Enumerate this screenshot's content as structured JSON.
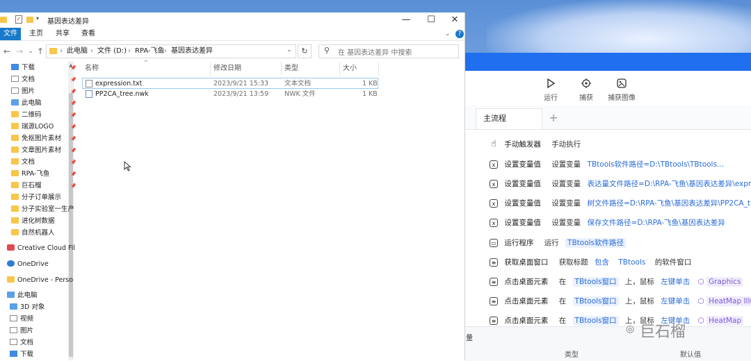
{
  "explorer": {
    "title": "基因表达差异",
    "ribbon": {
      "file": "文件",
      "home": "主页",
      "share": "共享",
      "view": "查看"
    },
    "breadcrumb": [
      "此电脑",
      "文件 (D:)",
      "RPA-飞鱼",
      "基因表达差异"
    ],
    "search_placeholder": "在 基因表达差异 中搜索",
    "columns": {
      "name": "名称",
      "date": "修改日期",
      "type": "类型",
      "size": "大小"
    },
    "files": [
      {
        "name": "expression.txt",
        "date": "2023/9/21 15:33",
        "type": "文本文档",
        "size": "1 KB"
      },
      {
        "name": "PP2CA_tree.nwk",
        "date": "2023/9/21 13:59",
        "type": "NWK 文件",
        "size": "1 KB"
      }
    ],
    "nav_items": [
      {
        "label": "下载",
        "icon": "download-icon",
        "pinned": true
      },
      {
        "label": "文档",
        "icon": "document-icon",
        "pinned": true
      },
      {
        "label": "图片",
        "icon": "pictures-icon",
        "pinned": true
      },
      {
        "label": "此电脑",
        "icon": "computer-icon",
        "pinned": true
      },
      {
        "label": "二维码",
        "icon": "folder-icon",
        "pinned": true
      },
      {
        "label": "瑞源LOGO",
        "icon": "folder-icon",
        "pinned": true
      },
      {
        "label": "免抠图片素材",
        "icon": "folder-icon",
        "pinned": true
      },
      {
        "label": "文章图片素材",
        "icon": "folder-icon",
        "pinned": true
      },
      {
        "label": "文档",
        "icon": "folder-icon",
        "pinned": true
      },
      {
        "label": "RPA-飞鱼",
        "icon": "folder-icon",
        "pinned": true
      },
      {
        "label": "巨石榴",
        "icon": "folder-icon",
        "pinned": true
      },
      {
        "label": "分子订单展示",
        "icon": "folder-icon",
        "pinned": false
      },
      {
        "label": "分子实验室一生产",
        "icon": "folder-icon",
        "pinned": false
      },
      {
        "label": "进化树数据",
        "icon": "folder-icon",
        "pinned": false
      },
      {
        "label": "自然机器人",
        "icon": "folder-icon",
        "pinned": false
      },
      {
        "label": "Creative Cloud Fil",
        "icon": "creative-cloud-icon",
        "pinned": false
      },
      {
        "label": "OneDrive",
        "icon": "onedrive-icon",
        "pinned": false
      },
      {
        "label": "OneDrive - Perso",
        "icon": "folder-icon",
        "pinned": false
      },
      {
        "label": "此电脑",
        "icon": "computer-icon",
        "pinned": false
      },
      {
        "label": "3D 对象",
        "icon": "3d-objects-icon",
        "pinned": false
      },
      {
        "label": "视频",
        "icon": "video-icon",
        "pinned": false
      },
      {
        "label": "图片",
        "icon": "pictures-icon",
        "pinned": false
      },
      {
        "label": "文档",
        "icon": "document-icon",
        "pinned": false
      },
      {
        "label": "下载",
        "icon": "download-icon",
        "pinned": false
      }
    ]
  },
  "rpa": {
    "toolbar": {
      "run": "运行",
      "capture": "捕获",
      "capture_image": "捕获图像"
    },
    "tab_main": "主流程",
    "tab_add": "+",
    "flow": [
      {
        "name": "手动触发器",
        "desc": "手动执行",
        "value": ""
      },
      {
        "name": "设置变量值",
        "desc": "设置变量",
        "value": "TBtools软件路径=D:\\TBtools\\TBtools..."
      },
      {
        "name": "设置变量值",
        "desc": "设置变量",
        "value": "表达量文件路径=D:\\RPA-飞鱼\\基因表达差异\\expre..."
      },
      {
        "name": "设置变量值",
        "desc": "设置变量",
        "value": "树文件路径=D:\\RPA-飞鱼\\基因表达差异\\PP2CA_t..."
      },
      {
        "name": "设置变量值",
        "desc": "设置变量",
        "value": "保存文件路径=D:\\RPA-飞鱼\\基因表达差异"
      },
      {
        "name": "运行程序",
        "desc": "运行",
        "value": "TBtools软件路径"
      },
      {
        "name": "获取桌面窗口",
        "desc": "获取标题",
        "value": "包含",
        "value2": "TBtools",
        "tail": "的软件窗口"
      },
      {
        "name": "点击桌面元素",
        "desc": "在",
        "value": "TBtools窗口",
        "mid": "上，鼠标",
        "action": "左键单击",
        "target": "Graphics"
      },
      {
        "name": "点击桌面元素",
        "desc": "在",
        "value": "TBtools窗口",
        "mid": "上，鼠标",
        "action": "左键单击",
        "target": "HeatMap Illustrator"
      },
      {
        "name": "点击桌面元素",
        "desc": "在",
        "value": "TBtools窗口",
        "mid": "上，鼠标",
        "action": "左键单击",
        "target": "HeatMap"
      }
    ],
    "bottom": {
      "section": "量",
      "col_type": "类型",
      "col_default": "默认值"
    }
  },
  "watermark": "巨石榴"
}
